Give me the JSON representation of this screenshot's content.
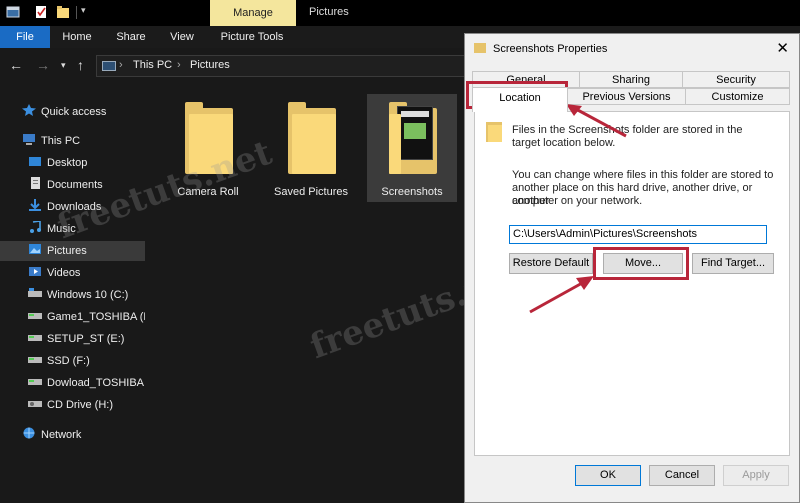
{
  "window": {
    "contextual_tab": "Manage",
    "title": "Pictures"
  },
  "ribbon": {
    "tabs": [
      "File",
      "Home",
      "Share",
      "View",
      "Picture Tools"
    ]
  },
  "address": {
    "segments": [
      "This PC",
      "Pictures"
    ]
  },
  "sidebar": {
    "items": [
      {
        "label": "Quick access",
        "icon": "star-icon"
      },
      {
        "label": "This PC",
        "icon": "computer-icon"
      },
      {
        "label": "Desktop",
        "icon": "desktop-icon"
      },
      {
        "label": "Documents",
        "icon": "documents-icon"
      },
      {
        "label": "Downloads",
        "icon": "downloads-icon"
      },
      {
        "label": "Music",
        "icon": "music-icon"
      },
      {
        "label": "Pictures",
        "icon": "pictures-icon"
      },
      {
        "label": "Videos",
        "icon": "videos-icon"
      },
      {
        "label": "Windows 10 (C:)",
        "icon": "drive-icon"
      },
      {
        "label": "Game1_TOSHIBA (D",
        "icon": "drive-icon"
      },
      {
        "label": "SETUP_ST (E:)",
        "icon": "drive-icon"
      },
      {
        "label": "SSD (F:)",
        "icon": "drive-icon"
      },
      {
        "label": "Dowload_TOSHIBA",
        "icon": "drive-icon"
      },
      {
        "label": "CD Drive (H:)",
        "icon": "cd-drive-icon"
      },
      {
        "label": "Network",
        "icon": "network-icon"
      }
    ]
  },
  "content": {
    "folders": [
      {
        "label": "Camera Roll"
      },
      {
        "label": "Saved Pictures"
      },
      {
        "label": "Screenshots"
      }
    ]
  },
  "dialog": {
    "title": "Screenshots Properties",
    "tabs_row1": [
      "General",
      "Sharing",
      "Security"
    ],
    "tabs_row2": [
      "Location",
      "Previous Versions",
      "Customize"
    ],
    "info_text_1": "Files in the Screenshots folder are stored in the",
    "info_text_2": "target location below.",
    "change_text_1": "You can change where files in this folder are stored to",
    "change_text_2": "another place on this hard drive, another drive, or another",
    "change_text_3": "computer on your network.",
    "path_value": "C:\\Users\\Admin\\Pictures\\Screenshots",
    "restore_default": "Restore Default",
    "move": "Move...",
    "find_target": "Find Target...",
    "ok": "OK",
    "cancel": "Cancel",
    "apply": "Apply"
  },
  "watermark": "freetuts.net",
  "colors": {
    "accent_file_tab": "#1a6bc4",
    "manage_tab": "#f4e69d",
    "highlight": "#b8263a",
    "folder": "#fad97a"
  }
}
